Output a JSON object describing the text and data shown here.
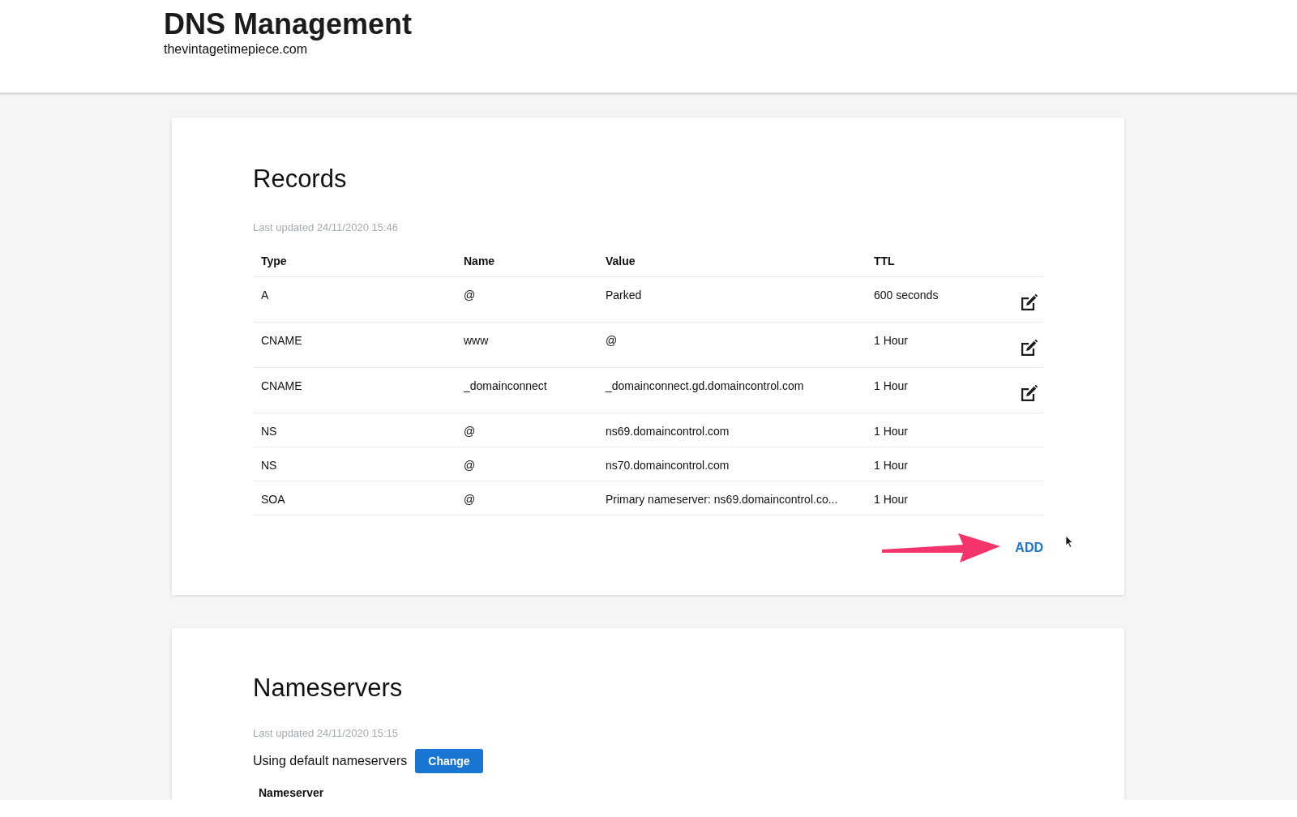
{
  "header": {
    "title": "DNS Management",
    "domain": "thevintagetimepiece.com"
  },
  "records": {
    "title": "Records",
    "last_updated": "Last updated 24/11/2020 15:46",
    "columns": [
      "Type",
      "Name",
      "Value",
      "TTL"
    ],
    "rows": [
      {
        "type": "A",
        "name": "@",
        "value": "Parked",
        "ttl": "600 seconds",
        "editable": true
      },
      {
        "type": "CNAME",
        "name": "www",
        "value": "@",
        "ttl": "1 Hour",
        "editable": true
      },
      {
        "type": "CNAME",
        "name": "_domainconnect",
        "value": "_domainconnect.gd.domaincontrol.com",
        "ttl": "1 Hour",
        "editable": true
      },
      {
        "type": "NS",
        "name": "@",
        "value": "ns69.domaincontrol.com",
        "ttl": "1 Hour",
        "editable": false
      },
      {
        "type": "NS",
        "name": "@",
        "value": "ns70.domaincontrol.com",
        "ttl": "1 Hour",
        "editable": false
      },
      {
        "type": "SOA",
        "name": "@",
        "value": "Primary nameserver: ns69.domaincontrol.co...",
        "ttl": "1 Hour",
        "editable": false
      }
    ],
    "add_button": "ADD"
  },
  "nameservers": {
    "title": "Nameservers",
    "last_updated": "Last updated 24/11/2020 15:15",
    "status": "Using default nameservers",
    "change_button": "Change",
    "columns": [
      "Nameserver"
    ]
  }
}
